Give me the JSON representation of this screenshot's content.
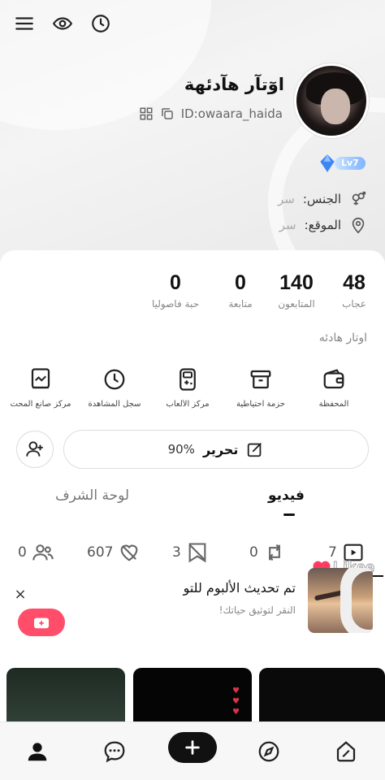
{
  "profile": {
    "name": "اوٓتآر هآدئهة",
    "id": "ID:owaara_haida",
    "level": "Lv7",
    "gender_label": "الجنس:",
    "gender_value": "سر",
    "location_label": "الموقع:",
    "location_value": "سر",
    "bio": "اوتار هادئه"
  },
  "stats": [
    {
      "num": "48",
      "label": "عجاب"
    },
    {
      "num": "140",
      "label": "المتابعون"
    },
    {
      "num": "0",
      "label": "متابعة"
    },
    {
      "num": "0",
      "label": "حبة فاصوليا"
    }
  ],
  "tools": [
    {
      "label": "المحفظة",
      "icon": "wallet-icon"
    },
    {
      "label": "حزمة احتياطية",
      "icon": "box-icon"
    },
    {
      "label": "مركز الألعاب",
      "icon": "game-icon"
    },
    {
      "label": "سجل المشاهدة",
      "icon": "clock-icon"
    },
    {
      "label": "مركز صانع المحت",
      "icon": "chart-book-icon"
    }
  ],
  "edit": {
    "label": "تحرير",
    "percent": "90%"
  },
  "tabs": {
    "video": "فيديو",
    "honor": "لوحة الشرف"
  },
  "counts": {
    "videos": "7",
    "reposts": "0",
    "mentions": "3",
    "likes": "607",
    "groups": "0"
  },
  "watermark": "Likee",
  "album": {
    "close": "×",
    "title": "تم تحديث الألبوم للتو",
    "subtitle": "النقر لتوثيق حياتك!"
  },
  "colors": {
    "accent": "#ff4d6a",
    "text": "#111111",
    "muted": "#888888"
  }
}
